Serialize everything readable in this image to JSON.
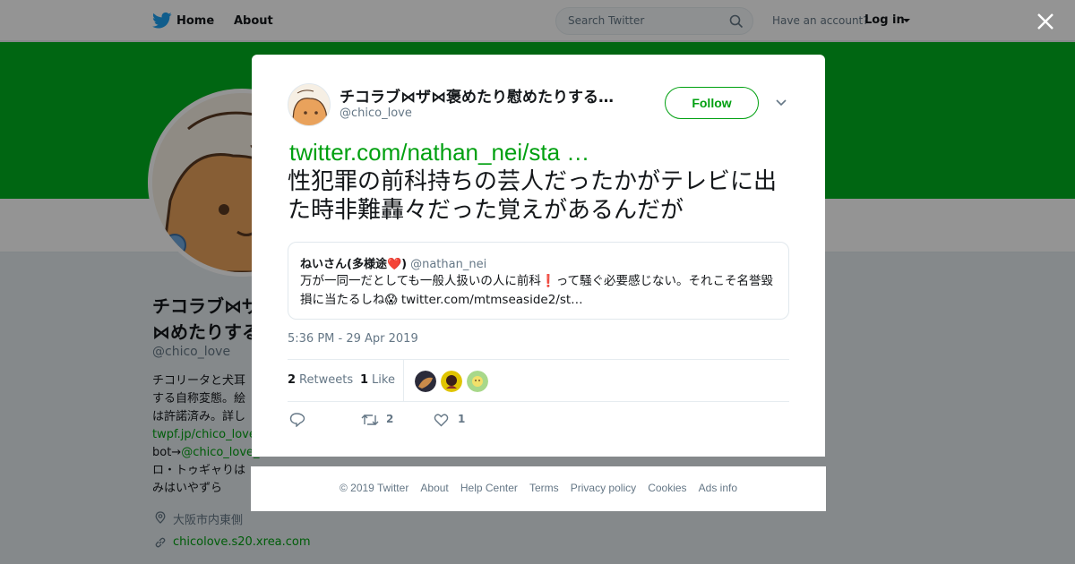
{
  "topnav": {
    "home_label": "Home",
    "about_label": "About",
    "search_placeholder": "Search Twitter",
    "have_account": "Have an account?",
    "login_label": "Log in"
  },
  "profile": {
    "name": "チコラブ⋈ザ⋈褒めたりする…",
    "name_short": "チコラブ⋈ザ⋈めたりする",
    "handle": "@chico_love",
    "bio_lines": [
      "チコリータと犬耳",
      "する自称変態。絵",
      "は許諾済み。詳し"
    ],
    "bio_link": "twpf.jp/chico_love",
    "bio_bot_prefix": "bot→",
    "bio_bot_link": "@chico_love_",
    "bio_line_5": "ロ・トゥギャりは",
    "bio_line_6": "みはいやずら",
    "location": "大阪市内東側",
    "website": "chicolove.s20.xrea.com",
    "banner_color": "#00b020",
    "link_color": "#00a010"
  },
  "tweet": {
    "author_name": "チコラブ⋈ザ⋈褒めたり慰めたりする…",
    "author_handle": "@chico_love",
    "follow_label": "Follow",
    "link_text": "twitter.com/nathan_nei/sta …",
    "text": "性犯罪の前科持ちの芸人だったかがテレビに出た時非難轟々だった覚えがあるんだが",
    "quote": {
      "name": "ねいさん(多様途❤️)",
      "handle": "@nathan_nei",
      "text": "万が一同一だとしても一般人扱いの人に前科❗って騒ぐ必要感じない。それこそ名誉毀損に当たるしね😱 twitter.com/mtmseaside2/st…"
    },
    "timestamp": "5:36 PM - 29 Apr 2019",
    "retweets_count": "2",
    "retweets_label": "Retweets",
    "likes_count": "1",
    "likes_label": "Like",
    "action_retweets": "2",
    "action_likes": "1"
  },
  "footer": {
    "items": [
      "© 2019 Twitter",
      "About",
      "Help Center",
      "Terms",
      "Privacy policy",
      "Cookies",
      "Ads info"
    ]
  }
}
